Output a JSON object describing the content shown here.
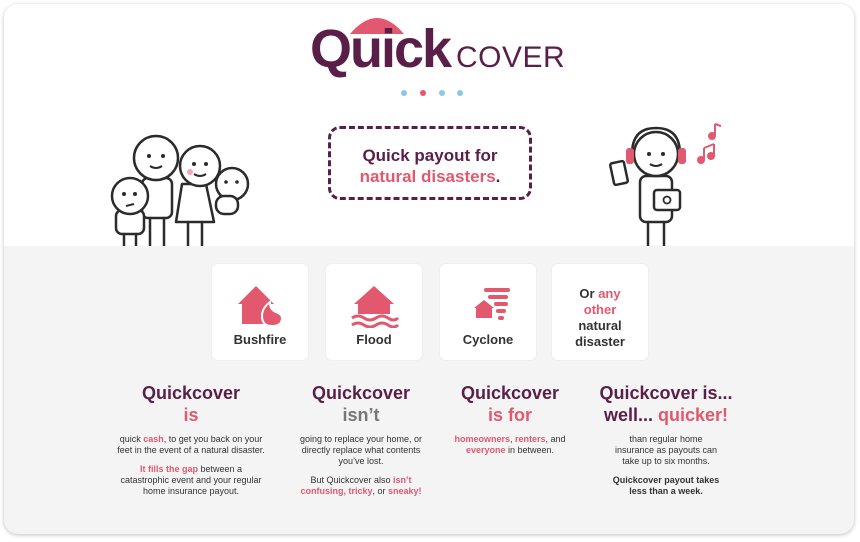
{
  "logo": {
    "quick": "Quick",
    "cover": "COVER"
  },
  "carousel": {
    "dot_count": 4,
    "active_index": 1
  },
  "callout": {
    "line1": "Quick payout for",
    "line2": "natural disasters",
    "period": "."
  },
  "cards": [
    {
      "label": "Bushfire",
      "icon": "house-fire-icon"
    },
    {
      "label": "Flood",
      "icon": "house-flood-icon"
    },
    {
      "label": "Cyclone",
      "icon": "cyclone-icon"
    }
  ],
  "other_card": {
    "or": "Or ",
    "any": "any",
    "other": "other",
    "natural": "natural",
    "disaster": "disaster"
  },
  "columns": {
    "is": {
      "heading": "Quickcover",
      "heading2": "is",
      "p1_a": "quick ",
      "p1_b": "cash",
      "p1_c": ", to get you back on your feet in the event of a natural disaster.",
      "p2_a": "It fills the gap",
      "p2_b": " between a catastrophic event and your regular home insurance payout."
    },
    "isnt": {
      "heading": "Quickcover",
      "heading2": "isn’t",
      "p1": "going to replace your home, or directly replace what contents you’ve lost.",
      "p2_a": "But Quickcover also ",
      "p2_b": "isn’t confusing, tricky",
      "p2_c": ", or ",
      "p2_d": "sneaky!"
    },
    "isfor": {
      "heading": "Quickcover",
      "heading2": "is for",
      "p1_a": "homeowners",
      "p1_b": ", ",
      "p1_c": "renters",
      "p1_d": ", and ",
      "p1_e": "everyone",
      "p1_f": " in between."
    },
    "quicker": {
      "heading": "Quickcover is...",
      "heading2_a": "well... ",
      "heading2_b": "quicker!",
      "p1": "than regular home insurance as payouts can take up to six months.",
      "p2": "Quickcover payout takes less than a week."
    }
  },
  "colors": {
    "brand": "#5a1f49",
    "accent": "#e2596f",
    "dot": "#8cc8e6"
  }
}
